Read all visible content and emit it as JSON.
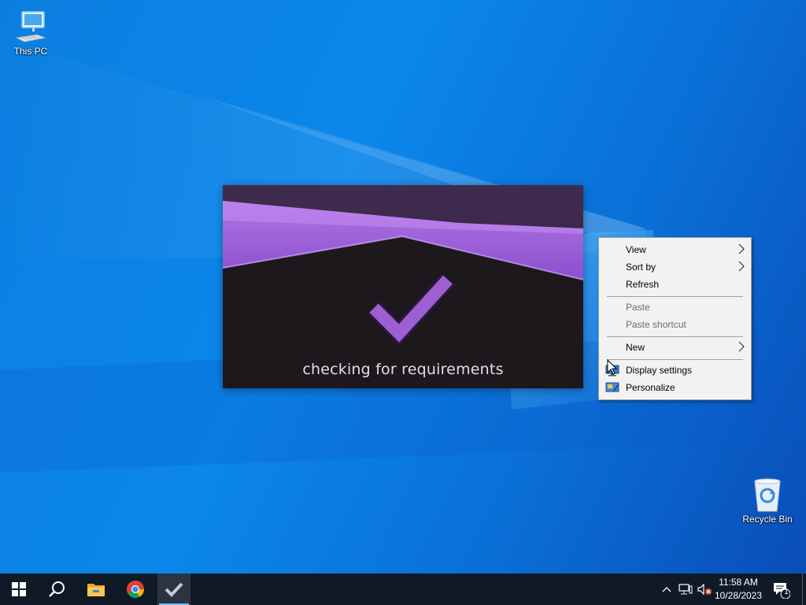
{
  "desktop": {
    "icons": [
      {
        "label": "This PC",
        "icon": "this-pc-icon"
      },
      {
        "label": "Recycle Bin",
        "icon": "recycle-bin-icon"
      }
    ]
  },
  "splash": {
    "status": "checking for requirements",
    "icon": "checkmark-icon",
    "colors": {
      "accent": "#9b59d0",
      "background": "#1c181c"
    }
  },
  "context_menu": {
    "items": [
      {
        "label": "View",
        "submenu": true
      },
      {
        "label": "Sort by",
        "submenu": true
      },
      {
        "label": "Refresh"
      },
      {
        "label": "Paste",
        "disabled": true
      },
      {
        "label": "Paste shortcut",
        "disabled": true
      },
      {
        "label": "New",
        "submenu": true
      },
      {
        "label": "Display settings",
        "icon": "display-settings-icon"
      },
      {
        "label": "Personalize",
        "icon": "personalize-icon"
      }
    ]
  },
  "taskbar": {
    "apps": [
      "start-icon",
      "search-icon",
      "file-explorer-icon",
      "chrome-icon",
      "checkmark-app-icon"
    ],
    "tray": [
      "chevron-up-icon",
      "network-icon",
      "volume-muted-icon"
    ],
    "clock": {
      "time": "11:58 AM",
      "date": "10/28/2023"
    },
    "notification_count": "1"
  }
}
